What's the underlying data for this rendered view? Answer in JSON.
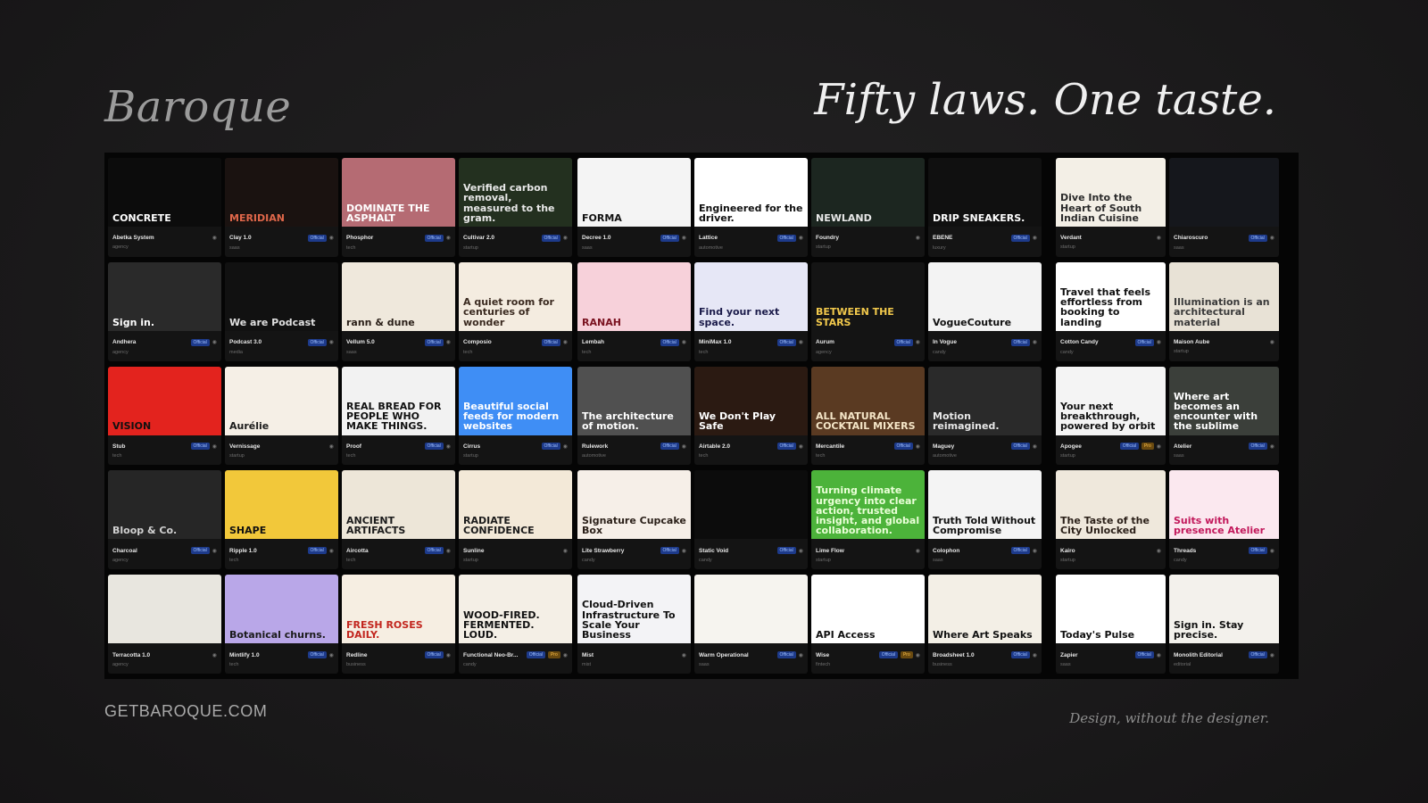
{
  "header": {
    "brand": "Baroque",
    "tagline": "Fifty laws. One taste."
  },
  "footer": {
    "site": "GETBAROQUE.COM",
    "tagline": "Design, without the designer."
  },
  "panels": [
    {
      "cards": [
        {
          "name": "Abetka System",
          "category": "agency",
          "official": false,
          "pro": false,
          "thumb_text": "CONCRETE",
          "bg": "#0c0c0c",
          "fg": "#ffffff"
        },
        {
          "name": "Clay 1.0",
          "category": "saas",
          "official": true,
          "pro": false,
          "thumb_text": "MERIDIAN",
          "bg": "#1a1210",
          "fg": "#e0674a"
        },
        {
          "name": "Phosphor",
          "category": "tech",
          "official": true,
          "pro": false,
          "thumb_text": "DOMINATE THE ASPHALT",
          "bg": "#b56b73",
          "fg": "#ffffff"
        },
        {
          "name": "Cultivar 2.0",
          "category": "startup",
          "official": true,
          "pro": false,
          "thumb_text": "Verified carbon removal, measured to the gram.",
          "bg": "#23301f",
          "fg": "#e8e8e8"
        },
        {
          "name": "Andhera",
          "category": "agency",
          "official": true,
          "pro": false,
          "thumb_text": "Sign in.",
          "bg": "#2a2a2a",
          "fg": "#ffffff"
        },
        {
          "name": "Podcast 3.0",
          "category": "media",
          "official": true,
          "pro": false,
          "thumb_text": "We are Podcast",
          "bg": "#111111",
          "fg": "#e0e0e0"
        },
        {
          "name": "Vellum 5.0",
          "category": "saas",
          "official": true,
          "pro": false,
          "thumb_text": "rann & dune",
          "bg": "#efe8dc",
          "fg": "#2a1f18"
        },
        {
          "name": "Composio",
          "category": "tech",
          "official": true,
          "pro": false,
          "thumb_text": "A quiet room for centuries of wonder",
          "bg": "#f4ece0",
          "fg": "#3a2a20"
        },
        {
          "name": "Stub",
          "category": "tech",
          "official": true,
          "pro": false,
          "thumb_text": "VISION",
          "bg": "#e3231e",
          "fg": "#111111"
        },
        {
          "name": "Vernissage",
          "category": "startup",
          "official": false,
          "pro": false,
          "thumb_text": "Aurélie",
          "bg": "#f5efe6",
          "fg": "#1b1b1b"
        },
        {
          "name": "Proof",
          "category": "tech",
          "official": true,
          "pro": false,
          "thumb_text": "REAL BREAD FOR PEOPLE WHO MAKE THINGS.",
          "bg": "#f2f2f2",
          "fg": "#111111"
        },
        {
          "name": "Cirrus",
          "category": "startup",
          "official": true,
          "pro": false,
          "thumb_text": "Beautiful social feeds for modern websites",
          "bg": "#3f8ef5",
          "fg": "#ffffff"
        },
        {
          "name": "Charcoal",
          "category": "agency",
          "official": true,
          "pro": false,
          "thumb_text": "Bloop & Co.",
          "bg": "#262626",
          "fg": "#d0d0d0"
        },
        {
          "name": "Ripple 1.0",
          "category": "tech",
          "official": true,
          "pro": false,
          "thumb_text": "SHAPE",
          "bg": "#f2c83a",
          "fg": "#111111"
        },
        {
          "name": "Aircotta",
          "category": "tech",
          "official": true,
          "pro": false,
          "thumb_text": "ANCIENT ARTIFACTS",
          "bg": "#ede6d8",
          "fg": "#1b1b1b"
        },
        {
          "name": "Sunline",
          "category": "startup",
          "official": false,
          "pro": false,
          "thumb_text": "RADIATE CONFIDENCE",
          "bg": "#f3e9d8",
          "fg": "#1b1b1b"
        },
        {
          "name": "Terracotta 1.0",
          "category": "agency",
          "official": false,
          "pro": false,
          "thumb_text": "",
          "bg": "#e8e6df",
          "fg": "#2a4a3a"
        },
        {
          "name": "Mintlify 1.0",
          "category": "tech",
          "official": true,
          "pro": false,
          "thumb_text": "Botanical churns.",
          "bg": "#b9a7e8",
          "fg": "#1b1b1b"
        },
        {
          "name": "Redline",
          "category": "business",
          "official": true,
          "pro": false,
          "thumb_text": "FRESH ROSES DAILY.",
          "bg": "#f6eee2",
          "fg": "#c2261e"
        },
        {
          "name": "Functional Neo-Br...",
          "category": "candy",
          "official": true,
          "pro": true,
          "thumb_text": "WOOD-FIRED. FERMENTED. LOUD.",
          "bg": "#f4efe6",
          "fg": "#111111"
        }
      ]
    },
    {
      "cards": [
        {
          "name": "Decree 1.0",
          "category": "saas",
          "official": true,
          "pro": false,
          "thumb_text": "FORMA",
          "bg": "#f4f4f4",
          "fg": "#111111"
        },
        {
          "name": "Lattice",
          "category": "automotive",
          "official": true,
          "pro": false,
          "thumb_text": "Engineered for the driver.",
          "bg": "#ffffff",
          "fg": "#111111"
        },
        {
          "name": "Foundry",
          "category": "startup",
          "official": false,
          "pro": false,
          "thumb_text": "NEWLAND",
          "bg": "#1c2620",
          "fg": "#e8e8e8"
        },
        {
          "name": "ÉBÈNE",
          "category": "luxury",
          "official": true,
          "pro": false,
          "thumb_text": "DRIP SNEAKERS.",
          "bg": "#101010",
          "fg": "#ffffff"
        },
        {
          "name": "Lembah",
          "category": "tech",
          "official": true,
          "pro": false,
          "thumb_text": "RANAH",
          "bg": "#f7d1da",
          "fg": "#7a1220"
        },
        {
          "name": "MiniMax 1.0",
          "category": "tech",
          "official": true,
          "pro": false,
          "thumb_text": "Find your next space.",
          "bg": "#e6e7f6",
          "fg": "#1b1b4a"
        },
        {
          "name": "Aurum",
          "category": "agency",
          "official": true,
          "pro": false,
          "thumb_text": "BETWEEN THE STARS",
          "bg": "#141414",
          "fg": "#f2c94c"
        },
        {
          "name": "In Vogue",
          "category": "candy",
          "official": true,
          "pro": false,
          "thumb_text": "VogueCouture",
          "bg": "#f3f3f3",
          "fg": "#111111"
        },
        {
          "name": "Rulework",
          "category": "automotive",
          "official": true,
          "pro": false,
          "thumb_text": "The architecture of motion.",
          "bg": "#505050",
          "fg": "#ffffff"
        },
        {
          "name": "Airtable 2.0",
          "category": "tech",
          "official": true,
          "pro": false,
          "thumb_text": "We Don't Play Safe",
          "bg": "#2b1a12",
          "fg": "#ffffff"
        },
        {
          "name": "Mercantile",
          "category": "tech",
          "official": true,
          "pro": false,
          "thumb_text": "ALL NATURAL COCKTAIL MIXERS",
          "bg": "#5a3a22",
          "fg": "#f5e6c8"
        },
        {
          "name": "Maguey",
          "category": "automotive",
          "official": true,
          "pro": false,
          "thumb_text": "Motion reimagined.",
          "bg": "#2a2a2a",
          "fg": "#e8e8e8"
        },
        {
          "name": "Lite Strawberry",
          "category": "candy",
          "official": true,
          "pro": false,
          "thumb_text": "Signature Cupcake Box",
          "bg": "#f6efe8",
          "fg": "#2a1f18"
        },
        {
          "name": "Static Void",
          "category": "candy",
          "official": true,
          "pro": false,
          "thumb_text": "",
          "bg": "#0c0c0c",
          "fg": "#d33"
        },
        {
          "name": "Lime Flow",
          "category": "startup",
          "official": false,
          "pro": false,
          "thumb_text": "Turning climate urgency into clear action, trusted insight, and global collaboration.",
          "bg": "#4cb33a",
          "fg": "#eaffd8"
        },
        {
          "name": "Colophon",
          "category": "saas",
          "official": true,
          "pro": false,
          "thumb_text": "Truth Told Without Compromise",
          "bg": "#f4f4f4",
          "fg": "#111111"
        },
        {
          "name": "Mist",
          "category": "mist",
          "official": false,
          "pro": false,
          "thumb_text": "Cloud-Driven Infrastructure To Scale Your Business",
          "bg": "#f3f3f6",
          "fg": "#111111"
        },
        {
          "name": "Warm Operational",
          "category": "saas",
          "official": true,
          "pro": false,
          "thumb_text": "",
          "bg": "#f6f4ef",
          "fg": "#333333"
        },
        {
          "name": "Wise",
          "category": "fintech",
          "official": true,
          "pro": true,
          "thumb_text": "API Access",
          "bg": "#ffffff",
          "fg": "#111111"
        },
        {
          "name": "Broadsheet 1.0",
          "category": "business",
          "official": true,
          "pro": false,
          "thumb_text": "Where Art Speaks",
          "bg": "#f3efe6",
          "fg": "#111111"
        }
      ]
    },
    {
      "cards": [
        {
          "name": "Verdant",
          "category": "startup",
          "official": false,
          "pro": false,
          "thumb_text": "Dive Into the Heart of South Indian Cuisine",
          "bg": "#f3efe6",
          "fg": "#2a2a2a"
        },
        {
          "name": "Chiaroscuro",
          "category": "saas",
          "official": true,
          "pro": false,
          "thumb_text": "",
          "bg": "#15171c",
          "fg": "#c0c8e0"
        },
        {
          "name": "Cotton Candy",
          "category": "candy",
          "official": true,
          "pro": false,
          "thumb_text": "Travel that feels effortless from booking to landing",
          "bg": "#ffffff",
          "fg": "#111111"
        },
        {
          "name": "Maison Aube",
          "category": "startup",
          "official": false,
          "pro": false,
          "thumb_text": "Illumination is an architectural material",
          "bg": "#e8e2d6",
          "fg": "#3a3a3a"
        },
        {
          "name": "Apogee",
          "category": "startup",
          "official": true,
          "pro": true,
          "thumb_text": "Your next breakthrough, powered by orbit",
          "bg": "#f4f4f4",
          "fg": "#111111"
        },
        {
          "name": "Atelier",
          "category": "saas",
          "official": true,
          "pro": false,
          "thumb_text": "Where art becomes an encounter with the sublime",
          "bg": "#3b3f3a",
          "fg": "#ffffff"
        },
        {
          "name": "Kairo",
          "category": "startup",
          "official": false,
          "pro": false,
          "thumb_text": "The Taste of the City Unlocked",
          "bg": "#efe8dc",
          "fg": "#2a1f18"
        },
        {
          "name": "Threads",
          "category": "candy",
          "official": true,
          "pro": false,
          "thumb_text": "Suits with presence Atelier",
          "bg": "#fbe8ef",
          "fg": "#c2185b"
        },
        {
          "name": "Zapier",
          "category": "saas",
          "official": true,
          "pro": false,
          "thumb_text": "Today's Pulse",
          "bg": "#ffffff",
          "fg": "#111111"
        },
        {
          "name": "Monolith Editorial",
          "category": "editorial",
          "official": true,
          "pro": false,
          "thumb_text": "Sign in. Stay precise.",
          "bg": "#f3f1ec",
          "fg": "#111111"
        }
      ]
    }
  ],
  "labels": {
    "official": "Official",
    "pro": "Pro"
  }
}
